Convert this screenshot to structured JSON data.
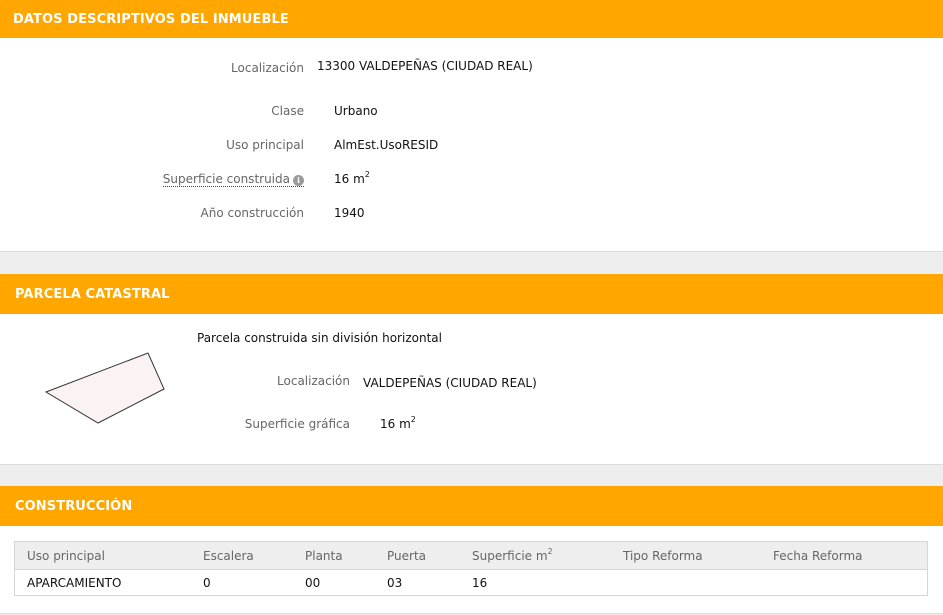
{
  "datos": {
    "header": "DATOS DESCRIPTIVOS DEL INMUEBLE",
    "fields": [
      {
        "label": "Localización",
        "value": "13300 VALDEPEÑAS (CIUDAD REAL)"
      },
      {
        "label": "Clase",
        "value": "Urbano"
      },
      {
        "label": "Uso principal",
        "value": "AlmEst.UsoRESID"
      },
      {
        "label": "Superficie construida",
        "value": "16 m",
        "unit_sup": "2",
        "info_icon": "info-icon"
      },
      {
        "label": "Año construcción",
        "value": "1940"
      }
    ]
  },
  "parcela": {
    "header": "PARCELA CATASTRAL",
    "description": "Parcela construida sin división horizontal",
    "localizacion_label": "Localización",
    "localizacion_value": "VALDEPEÑAS (CIUDAD REAL)",
    "superficie_label": "Superficie gráfica",
    "superficie_value": "16 m",
    "superficie_sup": "2"
  },
  "construccion": {
    "header": "CONSTRUCCIÓN",
    "columns": [
      "Uso principal",
      "Escalera",
      "Planta",
      "Puerta",
      "Superficie m",
      "Tipo Reforma",
      "Fecha Reforma"
    ],
    "superficie_col_sup": "2",
    "rows": [
      [
        "APARCAMIENTO",
        "0",
        "00",
        "03",
        "16",
        "",
        ""
      ]
    ]
  },
  "colors": {
    "header_bg": "#ffa700",
    "header_text": "#ffffff",
    "page_bg": "#eeeeee"
  }
}
